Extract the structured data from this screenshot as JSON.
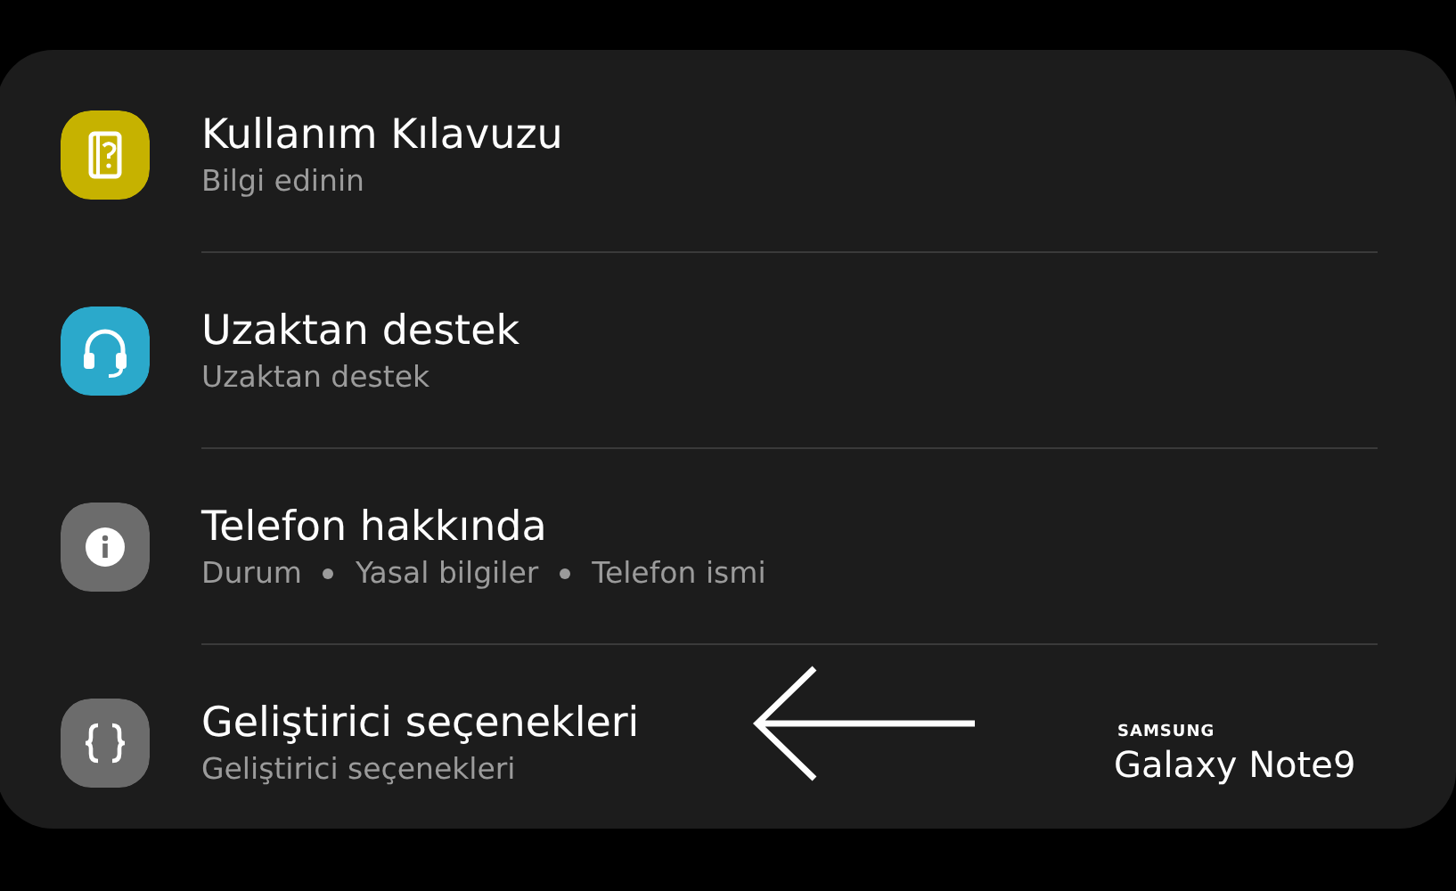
{
  "items": [
    {
      "kind": "guide",
      "title": "Kullanım Kılavuzu",
      "subtitle": "Bilgi edinin",
      "color": "#c6b200"
    },
    {
      "kind": "headset",
      "title": "Uzaktan destek",
      "subtitle": "Uzaktan destek",
      "color": "#2ba9cb"
    },
    {
      "kind": "info",
      "title": "Telefon hakkında",
      "subtitle_parts": [
        "Durum",
        "Yasal bilgiler",
        "Telefon ismi"
      ],
      "color": "#6c6c6c"
    },
    {
      "kind": "braces",
      "title": "Geliştirici seçenekleri",
      "subtitle": "Geliştirici seçenekleri",
      "color": "#6c6c6c"
    }
  ],
  "device_label": {
    "brand": "SAMSUNG",
    "model": "Galaxy Note9"
  }
}
